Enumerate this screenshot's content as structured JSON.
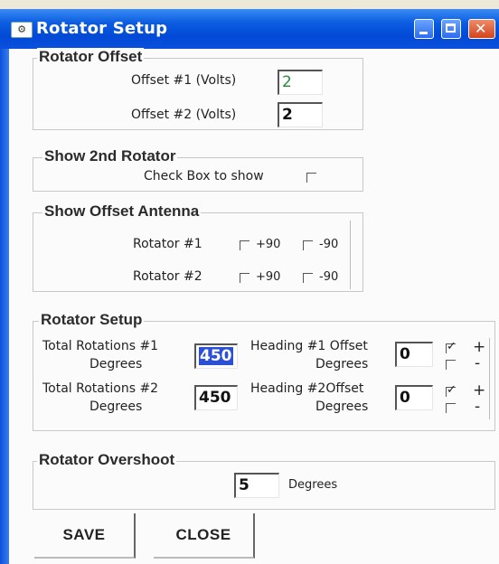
{
  "window": {
    "title": "Rotator Setup",
    "icon": "app-icon"
  },
  "offset": {
    "legend": "Rotator Offset",
    "offset1_label": "Offset #1 (Volts)",
    "offset1_value": "2",
    "offset2_label": "Offset #2 (Volts)",
    "offset2_value": "2"
  },
  "show2nd": {
    "legend": "Show 2nd Rotator",
    "checkbox_label": "Check Box to show",
    "checked": false
  },
  "antenna": {
    "legend": "Show Offset Antenna",
    "rows": [
      {
        "label": "Rotator #1",
        "plus": "+90",
        "minus": "-90"
      },
      {
        "label": "Rotator #2",
        "plus": "+90",
        "minus": "-90"
      }
    ]
  },
  "setup": {
    "legend": "Rotator Setup",
    "rows": [
      {
        "total_label_line1": "Total Rotations #1",
        "total_label_line2": "Degrees",
        "total_value": "450",
        "heading_label_line1": "Heading #1 Offset",
        "heading_label_line2": "Degrees",
        "heading_value": "0",
        "plus_label": "+",
        "minus_label": "-",
        "plus_checked": true,
        "minus_checked": false
      },
      {
        "total_label_line1": "Total Rotations #2",
        "total_label_line2": "Degrees",
        "total_value": "450",
        "heading_label_line1": "Heading #2Offset",
        "heading_label_line2": "Degrees",
        "heading_value": "0",
        "plus_label": "+",
        "minus_label": "-",
        "plus_checked": true,
        "minus_checked": false
      }
    ]
  },
  "overshoot": {
    "legend": "Rotator Overshoot",
    "value": "5",
    "unit": "Degrees"
  },
  "buttons": {
    "save": "SAVE",
    "close": "CLOSE"
  },
  "colors": {
    "titlebar": "#0149d6",
    "selection": "#2b4fd6",
    "green_text": "#2a8a3a"
  }
}
